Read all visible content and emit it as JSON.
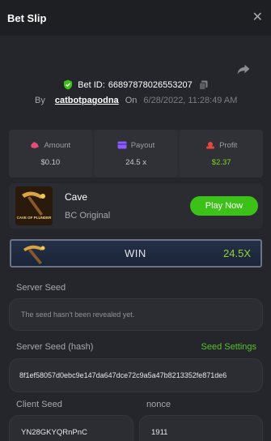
{
  "header": {
    "title": "Bet Slip",
    "close_symbol": "✕"
  },
  "bet": {
    "id_label": "Bet ID:",
    "id_value": "66897878026553207",
    "by_label": "By",
    "user": "catbotpagodna",
    "on_label": "On",
    "datetime": "6/28/2022, 11:28:49 AM"
  },
  "stats": [
    {
      "label": "Amount",
      "value": "$0.10",
      "icon": "amount-icon",
      "color": "#e94a7a"
    },
    {
      "label": "Payout",
      "value": "24.5 x",
      "icon": "payout-icon",
      "color": "#8b5cf6"
    },
    {
      "label": "Profit",
      "value": "$2.37",
      "icon": "profit-icon",
      "color": "#e8463d"
    }
  ],
  "game": {
    "name": "Cave",
    "provider": "BC Original",
    "play_label": "Play Now",
    "thumb_text": "CAVE OF PLUNDER"
  },
  "result": {
    "label": "WIN",
    "multiplier": "24.5X"
  },
  "seeds": {
    "server_seed_label": "Server Seed",
    "server_seed_value": "The seed hasn't been revealed yet.",
    "server_hash_label": "Server Seed (hash)",
    "seed_settings_label": "Seed Settings",
    "server_hash_value": "8f1ef58057d0ebc9e147da647dce72c9a5a47b8213352fe871de6",
    "client_seed_label": "Client Seed",
    "client_seed_value": "YN28GKYQRnPnC",
    "nonce_label": "nonce",
    "nonce_value": "1911"
  },
  "colors": {
    "accent_green": "#3bc117",
    "profit_green": "#7ed321",
    "background": "#24262b"
  }
}
